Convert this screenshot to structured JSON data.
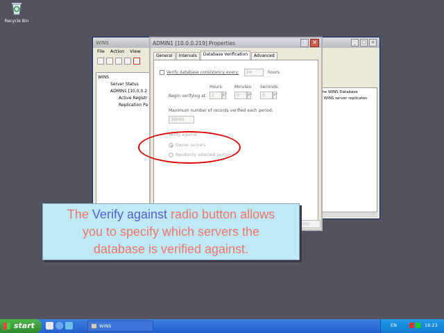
{
  "desktop": {
    "recycle_bin_label": "Recycle Bin"
  },
  "wins_window": {
    "title": "WINS",
    "menu": [
      "File",
      "Action",
      "View"
    ],
    "tree": [
      "WINS",
      "Server Status",
      "ADMIN1 [10.0.0.2",
      "Active Registr",
      "Replication Pa"
    ],
    "right_text": [
      "n the WINS Database",
      "his WINS server replicates"
    ]
  },
  "properties_dialog": {
    "title": "ADMIN1 [10.0.0.219] Properties",
    "help_button": "?",
    "close_button": "✕",
    "tabs": [
      "General",
      "Intervals",
      "Database Verification",
      "Advanced"
    ],
    "active_tab": "Database Verification",
    "verify_checkbox_label": "Verify database consistency every:",
    "every_value": "24",
    "every_unit": "hours",
    "begin_label": "Begin verifying at:",
    "hours_label": "Hours:",
    "minutes_label": "Minutes:",
    "seconds_label": "Seconds:",
    "hours_value": "2",
    "minutes_value": "0",
    "seconds_value": "0",
    "max_records_label": "Maximum number of records verified each period:",
    "max_records_value": "30000",
    "verify_against_label": "Verify against:",
    "radio_owner": "Owner servers",
    "radio_random": "Randomly selected partners",
    "apply_button": "Apply"
  },
  "callout": {
    "part1": "The ",
    "highlight1": "Verify",
    "part2": " ",
    "highlight2": "against",
    "part3": " radio button allows",
    "line2": "you to specify which servers the",
    "line3": "database is verified against."
  },
  "taskbar": {
    "start_label": "start",
    "task_wins": "WINS",
    "language": "EN",
    "clock": "16:23"
  },
  "colors": {
    "desktop": "#54525f",
    "callout_bg": "#bfeaf5",
    "callout_text": "#f1766c",
    "callout_highlight": "#5361d8",
    "annotation_ellipse": "#e10000"
  }
}
